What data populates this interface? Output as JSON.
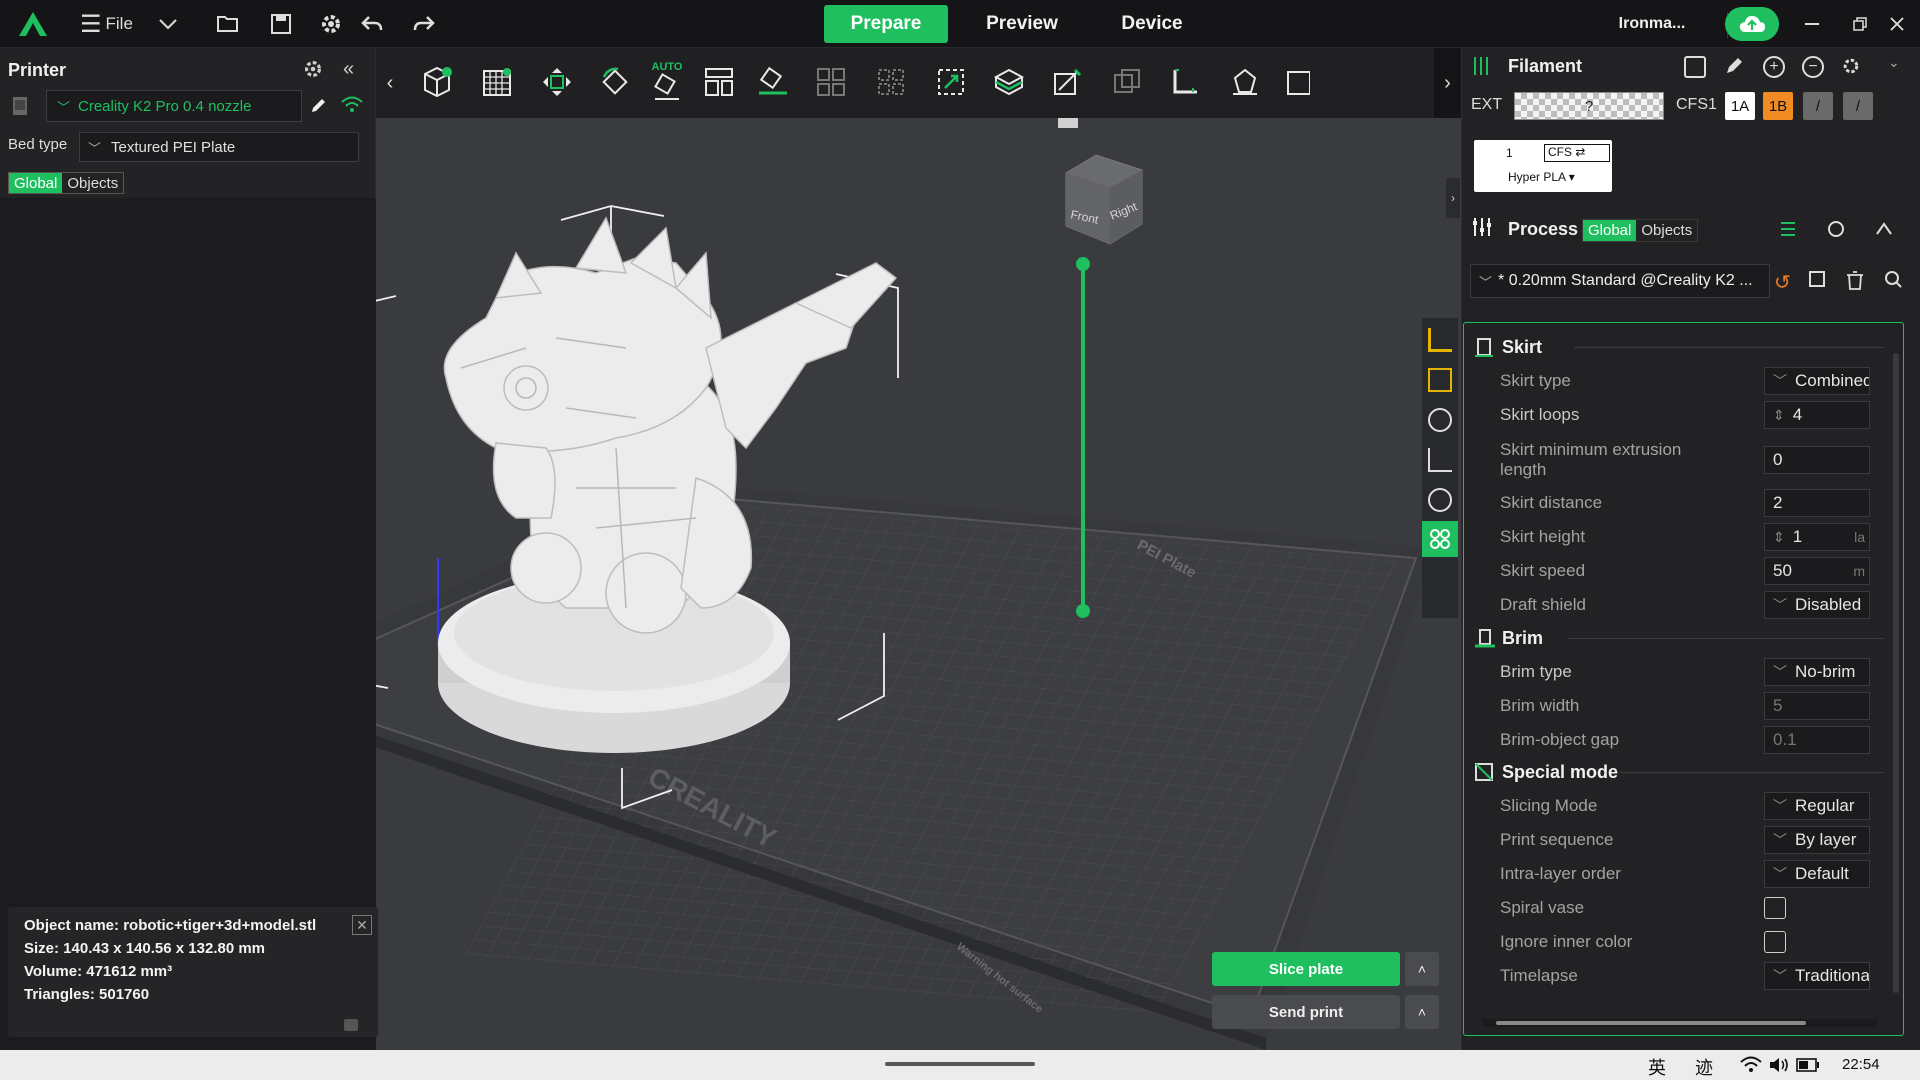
{
  "topbar": {
    "file_label": "File",
    "tabs": [
      {
        "label": "Prepare",
        "active": true
      },
      {
        "label": "Preview",
        "active": false
      },
      {
        "label": "Device",
        "active": false
      }
    ],
    "user": "Ironma...",
    "accent": "#1fbf5f"
  },
  "printer_panel": {
    "title": "Printer",
    "printer_name": "Creality K2 Pro 0.4 nozzle",
    "bed_type_label": "Bed type",
    "bed_type_value": "Textured PEI Plate",
    "tab_global": "Global",
    "tab_objects": "Objects"
  },
  "toolbar": {
    "auto_label": "AUTO",
    "icons": [
      "add-cube-icon",
      "grid-plate-icon",
      "move-icon",
      "rotate-icon",
      "auto-orient-icon",
      "arrange-icon",
      "lay-on-face-icon",
      "split-objects-icon",
      "split-parts-icon",
      "scale-icon",
      "cut-icon",
      "support-paint-icon",
      "seam-paint-icon",
      "boolean-icon",
      "measure-icon",
      "assembly-icon",
      "text-icon"
    ]
  },
  "view_cube": {
    "front": "Front",
    "right": "Right"
  },
  "bed_labels": {
    "brand": "CREALITY",
    "plate": "PEI Plate",
    "warning": "Warning hot surface"
  },
  "object_info": {
    "name": "Object name: robotic+tiger+3d+model.stl",
    "size": "Size: 140.43 x 140.56 x 132.80 mm",
    "volume": "Volume: 471612 mm³",
    "triangles": "Triangles: 501760"
  },
  "actions": {
    "slice": "Slice plate",
    "send": "Send print"
  },
  "filament": {
    "title": "Filament",
    "ext_label": "EXT",
    "ext_value": "?",
    "cfs_label": "CFS1",
    "slot_1a": "1A",
    "slot_1b": "1B",
    "slot_sep1": "/",
    "slot_sep2": "/",
    "card_index": "1",
    "card_cfs": "CFS ⇄",
    "card_material": "Hyper PLA ▾"
  },
  "process": {
    "title": "Process",
    "tab_global": "Global",
    "tab_objects": "Objects",
    "preset": "* 0.20mm Standard @Creality K2 ..."
  },
  "settings": {
    "skirt": {
      "title": "Skirt",
      "rows": [
        {
          "label": "Skirt type",
          "value": "Combined"
        },
        {
          "label": "Skirt loops",
          "value": "4"
        },
        {
          "label": "Skirt minimum extrusion length",
          "value": "0"
        },
        {
          "label": "Skirt distance",
          "value": "2"
        },
        {
          "label": "Skirt height",
          "value": "1",
          "unit": "la"
        },
        {
          "label": "Skirt speed",
          "value": "50",
          "unit": "m"
        },
        {
          "label": "Draft shield",
          "value": "Disabled"
        }
      ]
    },
    "brim": {
      "title": "Brim",
      "rows": [
        {
          "label": "Brim type",
          "value": "No-brim"
        },
        {
          "label": "Brim width",
          "value": "5"
        },
        {
          "label": "Brim-object gap",
          "value": "0.1"
        }
      ]
    },
    "special": {
      "title": "Special mode",
      "rows": [
        {
          "label": "Slicing Mode",
          "value": "Regular"
        },
        {
          "label": "Print sequence",
          "value": "By layer"
        },
        {
          "label": "Intra-layer order",
          "value": "Default"
        },
        {
          "label": "Spiral vase",
          "checked": false
        },
        {
          "label": "Ignore inner color",
          "checked": false
        },
        {
          "label": "Timelapse",
          "value": "Traditional"
        }
      ]
    }
  },
  "taskbar": {
    "ime1": "英",
    "ime2": "迹",
    "time": "22:54"
  }
}
